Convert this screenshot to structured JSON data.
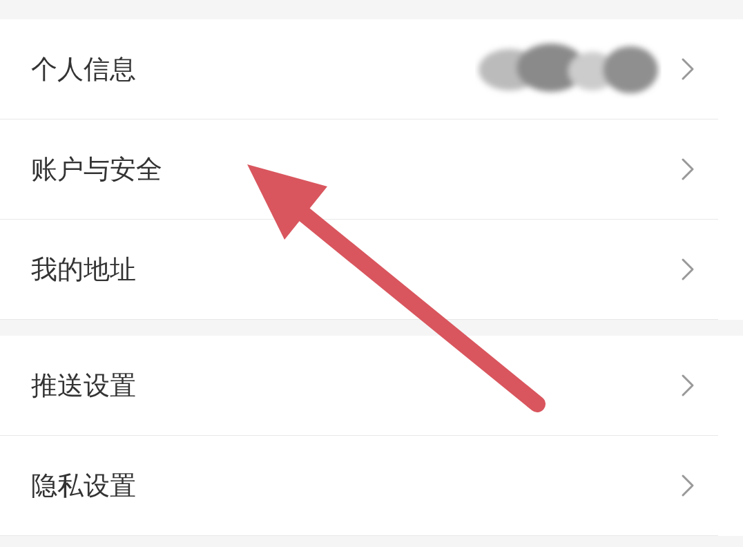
{
  "groups": [
    {
      "rows": [
        {
          "label": "个人信息",
          "redacted": true
        },
        {
          "label": "账户与安全",
          "redacted": false
        },
        {
          "label": "我的地址",
          "redacted": false
        }
      ]
    },
    {
      "rows": [
        {
          "label": "推送设置",
          "redacted": false
        },
        {
          "label": "隐私设置",
          "redacted": false
        }
      ]
    }
  ]
}
